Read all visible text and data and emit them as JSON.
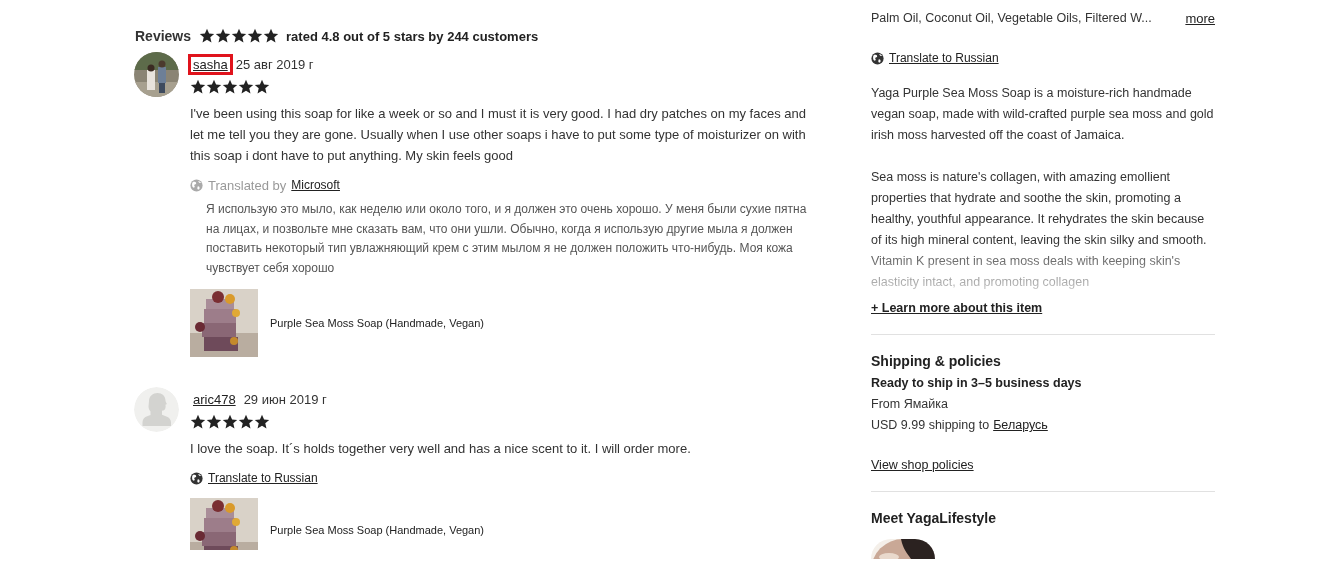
{
  "reviews_section": {
    "title": "Reviews",
    "stars": 5,
    "summary": "rated 4.8 out of 5 stars by 244 customers",
    "reviews": [
      {
        "name": "sasha",
        "highlighted": true,
        "date": "25 авг 2019 г",
        "stars": 5,
        "text": "I've been using this soap for like a week or so and I must it is very good. I had dry patches on my faces and let me tell you they are gone. Usually when I use other soaps i have to put some type of moisturizer on with this soap i dont have to put anything. My skin feels good",
        "translation": {
          "label": "Translated by",
          "provider": "Microsoft",
          "text": "Я использую это мыло, как неделю или около того, и я должен это очень хорошо. У меня были сухие пятна на лицах, и позвольте мне сказать вам, что они ушли. Обычно, когда я использую другие мыла я должен поставить некоторый тип увлажняющий крем с этим мылом я не должен положить что-нибудь. Моя кожа чувствует себя хорошо"
        },
        "product": "Purple Sea Moss Soap (Handmade, Vegan)"
      },
      {
        "avatar": {
          "kind": "silhouette"
        },
        "name": "aric478",
        "highlighted": false,
        "date": "29 июн 2019 г",
        "stars": 5,
        "text": "I love the soap. It´s holds together very well and has a nice scent to it. I will order more.",
        "translate_link": "Translate to Russian",
        "product": "Purple Sea Moss Soap (Handmade, Vegan)"
      }
    ]
  },
  "item_details": {
    "ingredients": "Palm Oil, Coconut Oil, Vegetable Oils, Filtered W...",
    "more_link": "more",
    "translate_link": "Translate to Russian",
    "description": [
      "Yaga Purple Sea Moss Soap is a moisture-rich handmade vegan soap, made with wild-crafted purple sea moss and gold irish moss harvested off the coast of Jamaica.",
      "Sea moss is nature's collagen, with amazing emollient properties that hydrate and soothe the skin, promoting a healthy, youthful appearance. It rehydrates the skin because of its high mineral content, leaving the skin silky and smooth. Vitamin K present in sea moss deals with keeping skin's elasticity intact, and promoting collagen"
    ],
    "learn_more_link": "+ Learn more about this item"
  },
  "shipping": {
    "title": "Shipping & policies",
    "ready": "Ready to ship in 3–5 business days",
    "from": "From Ямайка",
    "cost": "USD 9.99 shipping to",
    "destination_link": "Беларусь",
    "policies_link": "View shop policies"
  },
  "shop": {
    "title": "Meet YagaLifestyle"
  }
}
